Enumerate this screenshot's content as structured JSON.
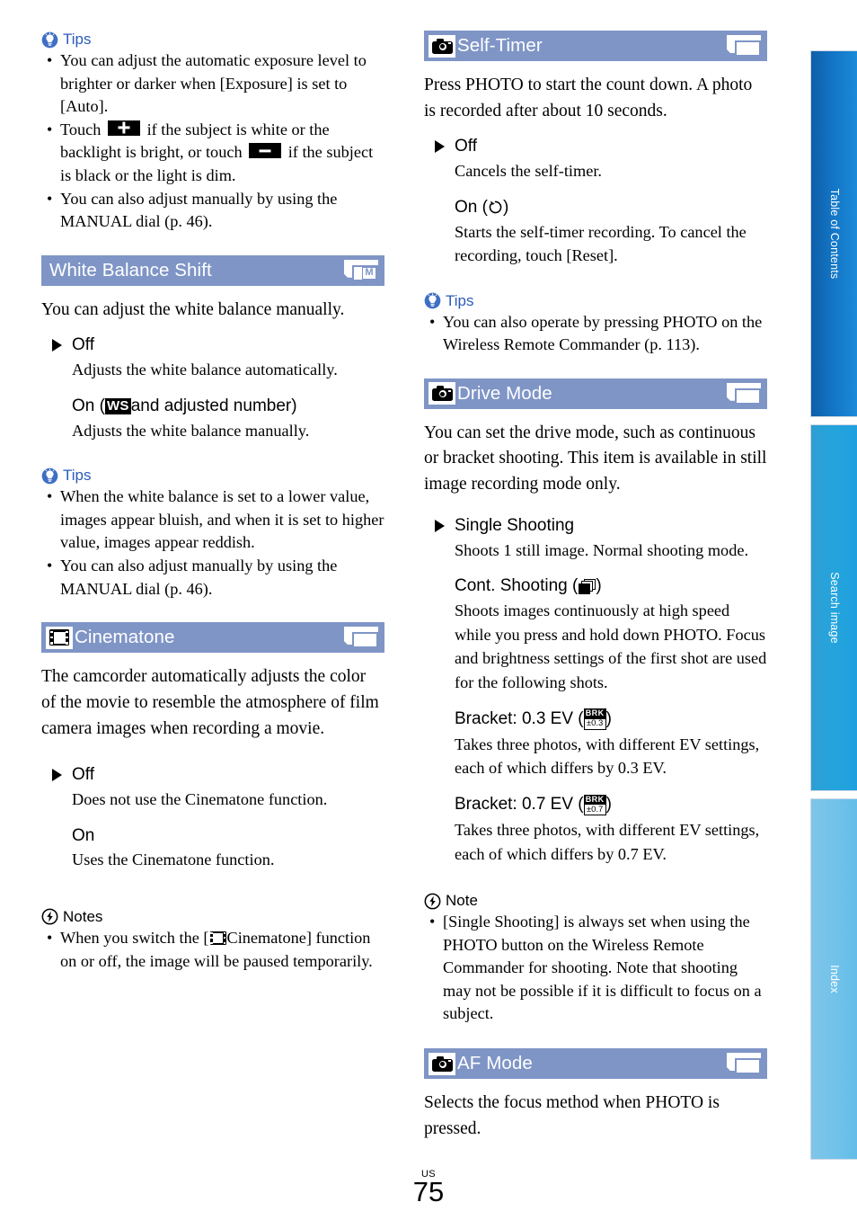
{
  "page": {
    "locale": "US",
    "number": "75"
  },
  "nav": {
    "tabs": [
      {
        "label": "Table of Contents",
        "color": "#1274c4"
      },
      {
        "label": "Search image",
        "color": "#25a4dc"
      },
      {
        "label": "Index",
        "color": "#74c3ea"
      }
    ]
  },
  "left_column": {
    "tips_exposure": {
      "heading": "Tips",
      "items": [
        "You can adjust the automatic exposure level to brighter or darker when [Exposure] is set to [Auto].",
        "Touch  {PLUS}  if the subject is white or the backlight is bright, or touch  {MINUS}  if the subject is black or the light is dim.",
        "You can also adjust manually by using the MANUAL dial (p. 46)."
      ]
    },
    "white_balance_shift": {
      "title": "White Balance Shift",
      "right_icon": "page-manual-icon",
      "right_icon_badge": "M",
      "intro": "You can adjust the white balance manually.",
      "options": [
        {
          "name": "Off",
          "default": true,
          "desc": "Adjusts the white balance automatically."
        },
        {
          "name_prefix": "On (",
          "inline_icon": "WS",
          "name_suffix": " and adjusted number)",
          "default": false,
          "desc": "Adjusts the white balance manually."
        }
      ]
    },
    "tips_white_balance": {
      "heading": "Tips",
      "items": [
        "When the white balance is set to a lower value, images appear bluish, and when it is set to higher value, images appear reddish.",
        "You can also adjust manually by using the MANUAL dial (p. 46)."
      ]
    },
    "cinematone": {
      "title": "Cinematone",
      "left_icon": "film-strip-icon",
      "right_icon": "page-icon",
      "intro": "The camcorder automatically adjusts the color of the movie to resemble the atmosphere of film camera images when recording a movie.",
      "options": [
        {
          "name": "Off",
          "default": true,
          "desc": "Does not use the Cinematone function."
        },
        {
          "name": "On",
          "default": false,
          "desc": "Uses the Cinematone function."
        }
      ]
    },
    "notes_cinematone": {
      "heading": "Notes",
      "item_pre": "When you switch the [",
      "item_post": "Cinematone] function on or off, the image will be paused temporarily."
    }
  },
  "right_column": {
    "self_timer": {
      "title": "Self-Timer",
      "left_icon": "camera-icon",
      "right_icon": "page-icon",
      "intro": "Press PHOTO to start the count down. A photo is recorded after about 10 seconds.",
      "options": [
        {
          "name": "Off",
          "default": true,
          "desc": "Cancels the self-timer."
        },
        {
          "name_prefix": "On (",
          "inline_icon": "self-timer-icon",
          "name_suffix": ")",
          "default": false,
          "desc": "Starts the self-timer recording. To cancel the recording, touch [Reset]."
        }
      ]
    },
    "tips_self_timer": {
      "heading": "Tips",
      "items": [
        "You can also operate by pressing PHOTO on the Wireless Remote Commander (p. 113)."
      ]
    },
    "drive_mode": {
      "title": "Drive Mode",
      "left_icon": "camera-icon",
      "right_icon": "page-icon",
      "intro": "You can set the drive mode, such as continuous or bracket shooting. This item is available in still image recording mode only.",
      "options": [
        {
          "name": "Single Shooting",
          "default": true,
          "desc": "Shoots 1 still image. Normal shooting mode."
        },
        {
          "name_prefix": "Cont. Shooting (",
          "inline_icon": "burst-icon",
          "name_suffix": ")",
          "default": false,
          "desc": "Shoots images continuously at high speed while you press and hold down PHOTO. Focus and brightness settings of the first shot are used for the following shots."
        },
        {
          "name_prefix": "Bracket: 0.3 EV (",
          "inline_icon": "brk-icon",
          "icon_top": "BRK",
          "icon_bottom": "±0.3",
          "name_suffix": ")",
          "default": false,
          "desc": "Takes three photos, with different EV settings, each of which differs by 0.3 EV."
        },
        {
          "name_prefix": "Bracket: 0.7 EV (",
          "inline_icon": "brk-icon",
          "icon_top": "BRK",
          "icon_bottom": "±0.7",
          "name_suffix": ")",
          "default": false,
          "desc": "Takes three photos, with different EV settings, each of which differs by 0.7 EV."
        }
      ]
    },
    "note_drive_mode": {
      "heading": "Note",
      "items": [
        "[Single Shooting] is always set when using the PHOTO button on the Wireless Remote Commander for shooting. Note that shooting may not be possible if it is difficult to focus on a subject."
      ]
    },
    "af_mode": {
      "title": "AF Mode",
      "left_icon": "camera-icon",
      "right_icon": "page-icon",
      "intro": "Selects the focus method when PHOTO is pressed."
    }
  },
  "colors": {
    "section_bar": "#7f95c6",
    "tips_label": "#2a5cb8"
  }
}
